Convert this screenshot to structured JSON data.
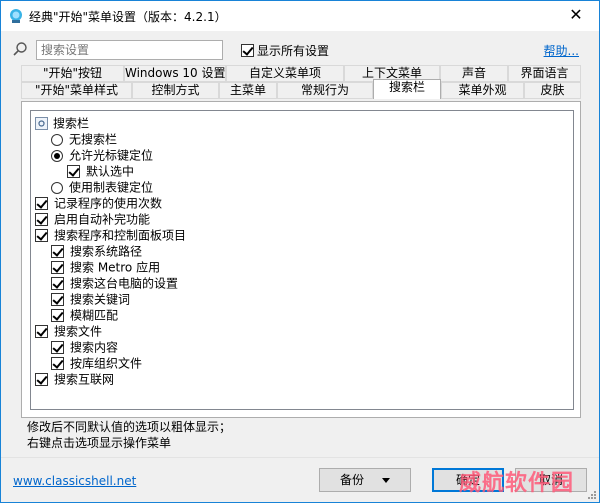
{
  "window": {
    "title": "经典\"开始\"菜单设置（版本：4.2.1）",
    "close": "✕"
  },
  "search": {
    "placeholder": "搜索设置",
    "value": "",
    "show_all_label": "显示所有设置",
    "show_all_checked": true,
    "help_label": "帮助..."
  },
  "tabs_row1": [
    {
      "label": "\"开始\"按钮"
    },
    {
      "label": "Windows 10 设置"
    },
    {
      "label": "自定义菜单项"
    },
    {
      "label": "上下文菜单"
    },
    {
      "label": "声音"
    },
    {
      "label": "界面语言"
    }
  ],
  "tabs_row2": [
    {
      "label": "\"开始\"菜单样式"
    },
    {
      "label": "控制方式"
    },
    {
      "label": "主菜单"
    },
    {
      "label": "常规行为"
    },
    {
      "label": "搜索栏",
      "active": true
    },
    {
      "label": "菜单外观"
    },
    {
      "label": "皮肤"
    }
  ],
  "tree": {
    "group_label": "搜索栏",
    "items": [
      {
        "type": "radio",
        "checked": false,
        "label": "无搜索栏"
      },
      {
        "type": "radio",
        "checked": true,
        "label": "允许光标键定位"
      },
      {
        "type": "checkbox",
        "checked": true,
        "label": "默认选中"
      },
      {
        "type": "radio",
        "checked": false,
        "label": "使用制表键定位"
      },
      {
        "type": "checkbox",
        "checked": true,
        "label": "记录程序的使用次数"
      },
      {
        "type": "checkbox",
        "checked": true,
        "label": "启用自动补完功能"
      },
      {
        "type": "checkbox",
        "checked": true,
        "label": "搜索程序和控制面板项目"
      },
      {
        "type": "checkbox",
        "checked": true,
        "label": "搜索系统路径"
      },
      {
        "type": "checkbox",
        "checked": true,
        "label": "搜索 Metro 应用"
      },
      {
        "type": "checkbox",
        "checked": true,
        "label": "搜索这台电脑的设置"
      },
      {
        "type": "checkbox",
        "checked": true,
        "label": "搜索关键词"
      },
      {
        "type": "checkbox",
        "checked": true,
        "label": "模糊匹配"
      },
      {
        "type": "checkbox",
        "checked": true,
        "label": "搜索文件"
      },
      {
        "type": "checkbox",
        "checked": true,
        "label": "搜索内容"
      },
      {
        "type": "checkbox",
        "checked": true,
        "label": "按库组织文件"
      },
      {
        "type": "checkbox",
        "checked": true,
        "label": "搜索互联网"
      }
    ]
  },
  "info": {
    "line1": "修改后不同默认值的选项以粗体显示；",
    "line2": "右键点击选项显示操作菜单"
  },
  "footer": {
    "site": "www.classicshell.net",
    "backup": "备份",
    "ok": "确定",
    "cancel": "取消",
    "watermark": "威航软件园"
  },
  "colors": {
    "accent": "#0078d7",
    "link": "#0066cc",
    "border": "#1883d7"
  }
}
